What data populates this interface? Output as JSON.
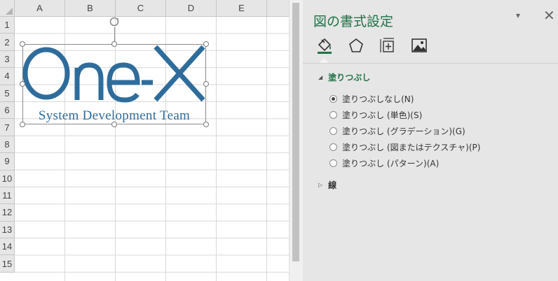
{
  "sheet": {
    "columns": [
      "A",
      "B",
      "C",
      "D",
      "E"
    ],
    "rows": [
      "1",
      "2",
      "3",
      "4",
      "5",
      "6",
      "7",
      "8",
      "9",
      "10",
      "11",
      "12",
      "13",
      "14",
      "15"
    ]
  },
  "picture": {
    "logo_text": "One-X",
    "subtitle": "System Development Team",
    "logo_color": "#2e6c9c"
  },
  "pane": {
    "title": "図の書式設定",
    "menu_glyph": "▾",
    "close_glyph": "✕",
    "tabs": [
      {
        "icon": "fill-bucket-icon"
      },
      {
        "icon": "pentagon-icon"
      },
      {
        "icon": "size-properties-icon"
      },
      {
        "icon": "picture-icon"
      }
    ],
    "fill_section": {
      "label": "塗りつぶし",
      "expanded_glyph": "◢",
      "options": [
        {
          "label": "塗りつぶしなし(N)",
          "selected": true
        },
        {
          "label": "塗りつぶし (単色)(S)",
          "selected": false
        },
        {
          "label": "塗りつぶし (グラデーション)(G)",
          "selected": false
        },
        {
          "label": "塗りつぶし (図またはテクスチャ)(P)",
          "selected": false
        },
        {
          "label": "塗りつぶし (パターン)(A)",
          "selected": false
        }
      ]
    },
    "line_section": {
      "label": "線",
      "collapsed_glyph": "▷"
    }
  },
  "accent_color": "#217346"
}
